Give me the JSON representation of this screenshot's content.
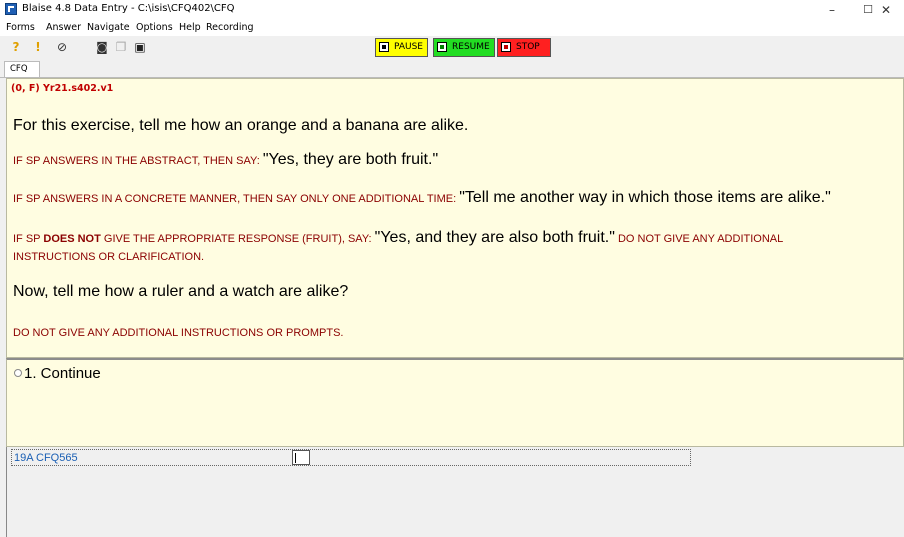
{
  "window": {
    "title": "Blaise 4.8 Data Entry - C:\\isis\\CFQ402\\CFQ",
    "minimize": "–",
    "maximize": "☐",
    "close": "✕"
  },
  "menu": [
    "Forms",
    "Answer",
    "Navigate",
    "Options",
    "Help",
    "Recording"
  ],
  "toolbar": {
    "pause_label": "PAUSE",
    "resume_label": "RESUME",
    "stop_label": "STOP",
    "colors": {
      "pause": "#ffff00",
      "resume": "#22dd22",
      "stop": "#ff2020"
    }
  },
  "tabs": [
    "CFQ"
  ],
  "question": {
    "id": "(0, F)  Yr21.s402.v1",
    "line1": "For this exercise, tell me how an orange and a banana are alike.",
    "l2_instr": "IF SP ANSWERS IN THE ABSTRACT, THEN SAY: ",
    "l2_say": "\"Yes, they are both fruit.\"",
    "l3_instr": "IF SP ANSWERS IN A CONCRETE MANNER, THEN SAY ONLY ONE ADDITIONAL TIME: ",
    "l3_say": "\"Tell me another way in which those items are alike.\"",
    "l4_instr_a": "IF SP ",
    "l4_bold": "DOES NOT",
    "l4_instr_b": " GIVE THE APPROPRIATE RESPONSE (FRUIT), SAY: ",
    "l4_say": "\"Yes, and they are also both fruit.\"",
    "l4_instr_c": " DO NOT GIVE ANY ADDITIONAL",
    "l4_instr_d": "INSTRUCTIONS OR CLARIFICATION.",
    "line5": "Now, tell me how a ruler and a watch are alike?",
    "line6": "DO NOT GIVE ANY ADDITIONAL INSTRUCTIONS OR PROMPTS."
  },
  "answers": [
    {
      "label": "1. Continue"
    }
  ],
  "field": {
    "label": "19A CFQ565",
    "value": ""
  }
}
